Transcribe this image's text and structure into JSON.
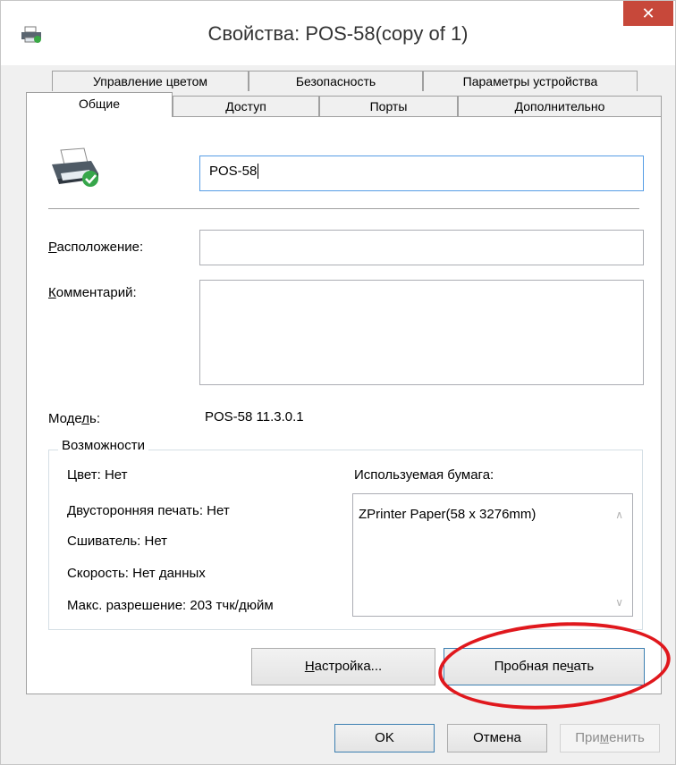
{
  "window": {
    "title": "Свойства: POS-58(copy of 1)",
    "close_symbol": "✕",
    "icon": "printer-icon"
  },
  "tabs": {
    "row1": [
      "Управление цветом",
      "Безопасность",
      "Параметры устройства"
    ],
    "row2": [
      "Общие",
      "Доступ",
      "Порты",
      "Дополнительно"
    ],
    "active": "Общие"
  },
  "general": {
    "printer_name": "POS-58",
    "location_label_first": "Р",
    "location_label_rest": "асположение:",
    "location_value": "",
    "comment_label_first": "К",
    "comment_label_rest": "омментарий:",
    "comment_value": "",
    "model_label_a": "Моде",
    "model_label_u": "л",
    "model_label_b": "ь:",
    "model_value": "POS-58 11.3.0.1"
  },
  "features": {
    "title": "Возможности",
    "color": "Цвет: Нет",
    "duplex": "Двусторонняя печать: Нет",
    "stapler": "Сшиватель: Нет",
    "speed": "Скорость: Нет данных",
    "max_resolution": "Макс. разрешение: 203 тчк/дюйм",
    "paper_label": "Используемая бумага:",
    "paper_items": [
      "ZPrinter Paper(58 x 3276mm)"
    ]
  },
  "buttons": {
    "settings_first": "Н",
    "settings_rest": "астройка...",
    "test_print_a": "Пробная пе",
    "test_print_u": "ч",
    "test_print_b": "ать",
    "ok": "OK",
    "cancel": "Отмена",
    "apply_a": "При",
    "apply_u": "м",
    "apply_b": "енить"
  },
  "colors": {
    "accent": "#3c7fb1",
    "close_button": "#c7483a",
    "highlight_ellipse": "#e0181d"
  }
}
